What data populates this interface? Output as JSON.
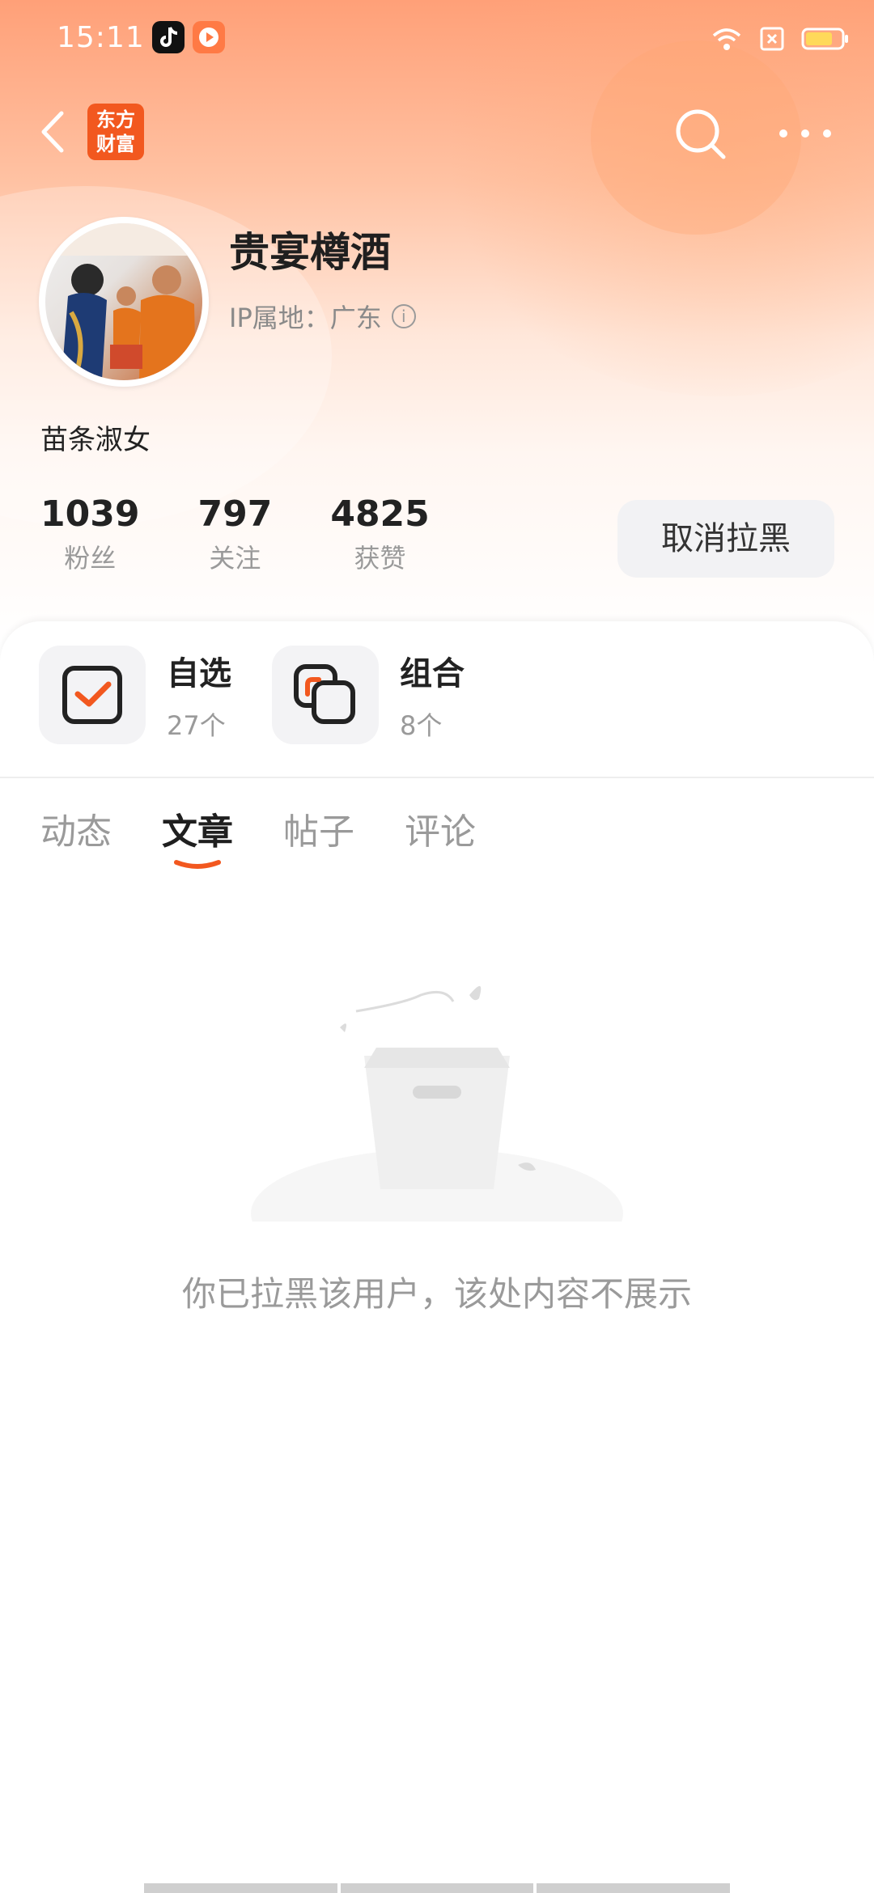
{
  "status_bar": {
    "time": "15:11",
    "apps": [
      "tiktok-icon",
      "video-app-icon"
    ],
    "right_icons": [
      "wifi-icon",
      "sim-icon",
      "battery-icon"
    ]
  },
  "nav": {
    "logo_line1": "东方",
    "logo_line2": "财富",
    "logo_color": "#f2581f"
  },
  "profile": {
    "name": "贵宴樽酒",
    "ip_label": "IP属地：广东",
    "bio": "苗条淑女",
    "stats": [
      {
        "num": "1039",
        "label": "粉丝"
      },
      {
        "num": "797",
        "label": "关注"
      },
      {
        "num": "4825",
        "label": "获赞"
      }
    ],
    "unblock_label": "取消拉黑"
  },
  "card": {
    "items": [
      {
        "title": "自选",
        "count": "27个"
      },
      {
        "title": "组合",
        "count": "8个"
      }
    ]
  },
  "tabs": {
    "items": [
      "动态",
      "文章",
      "帖子",
      "评论"
    ],
    "active": "文章",
    "accent": "#f2581f"
  },
  "empty": {
    "message": "你已拉黑该用户，该处内容不展示"
  }
}
